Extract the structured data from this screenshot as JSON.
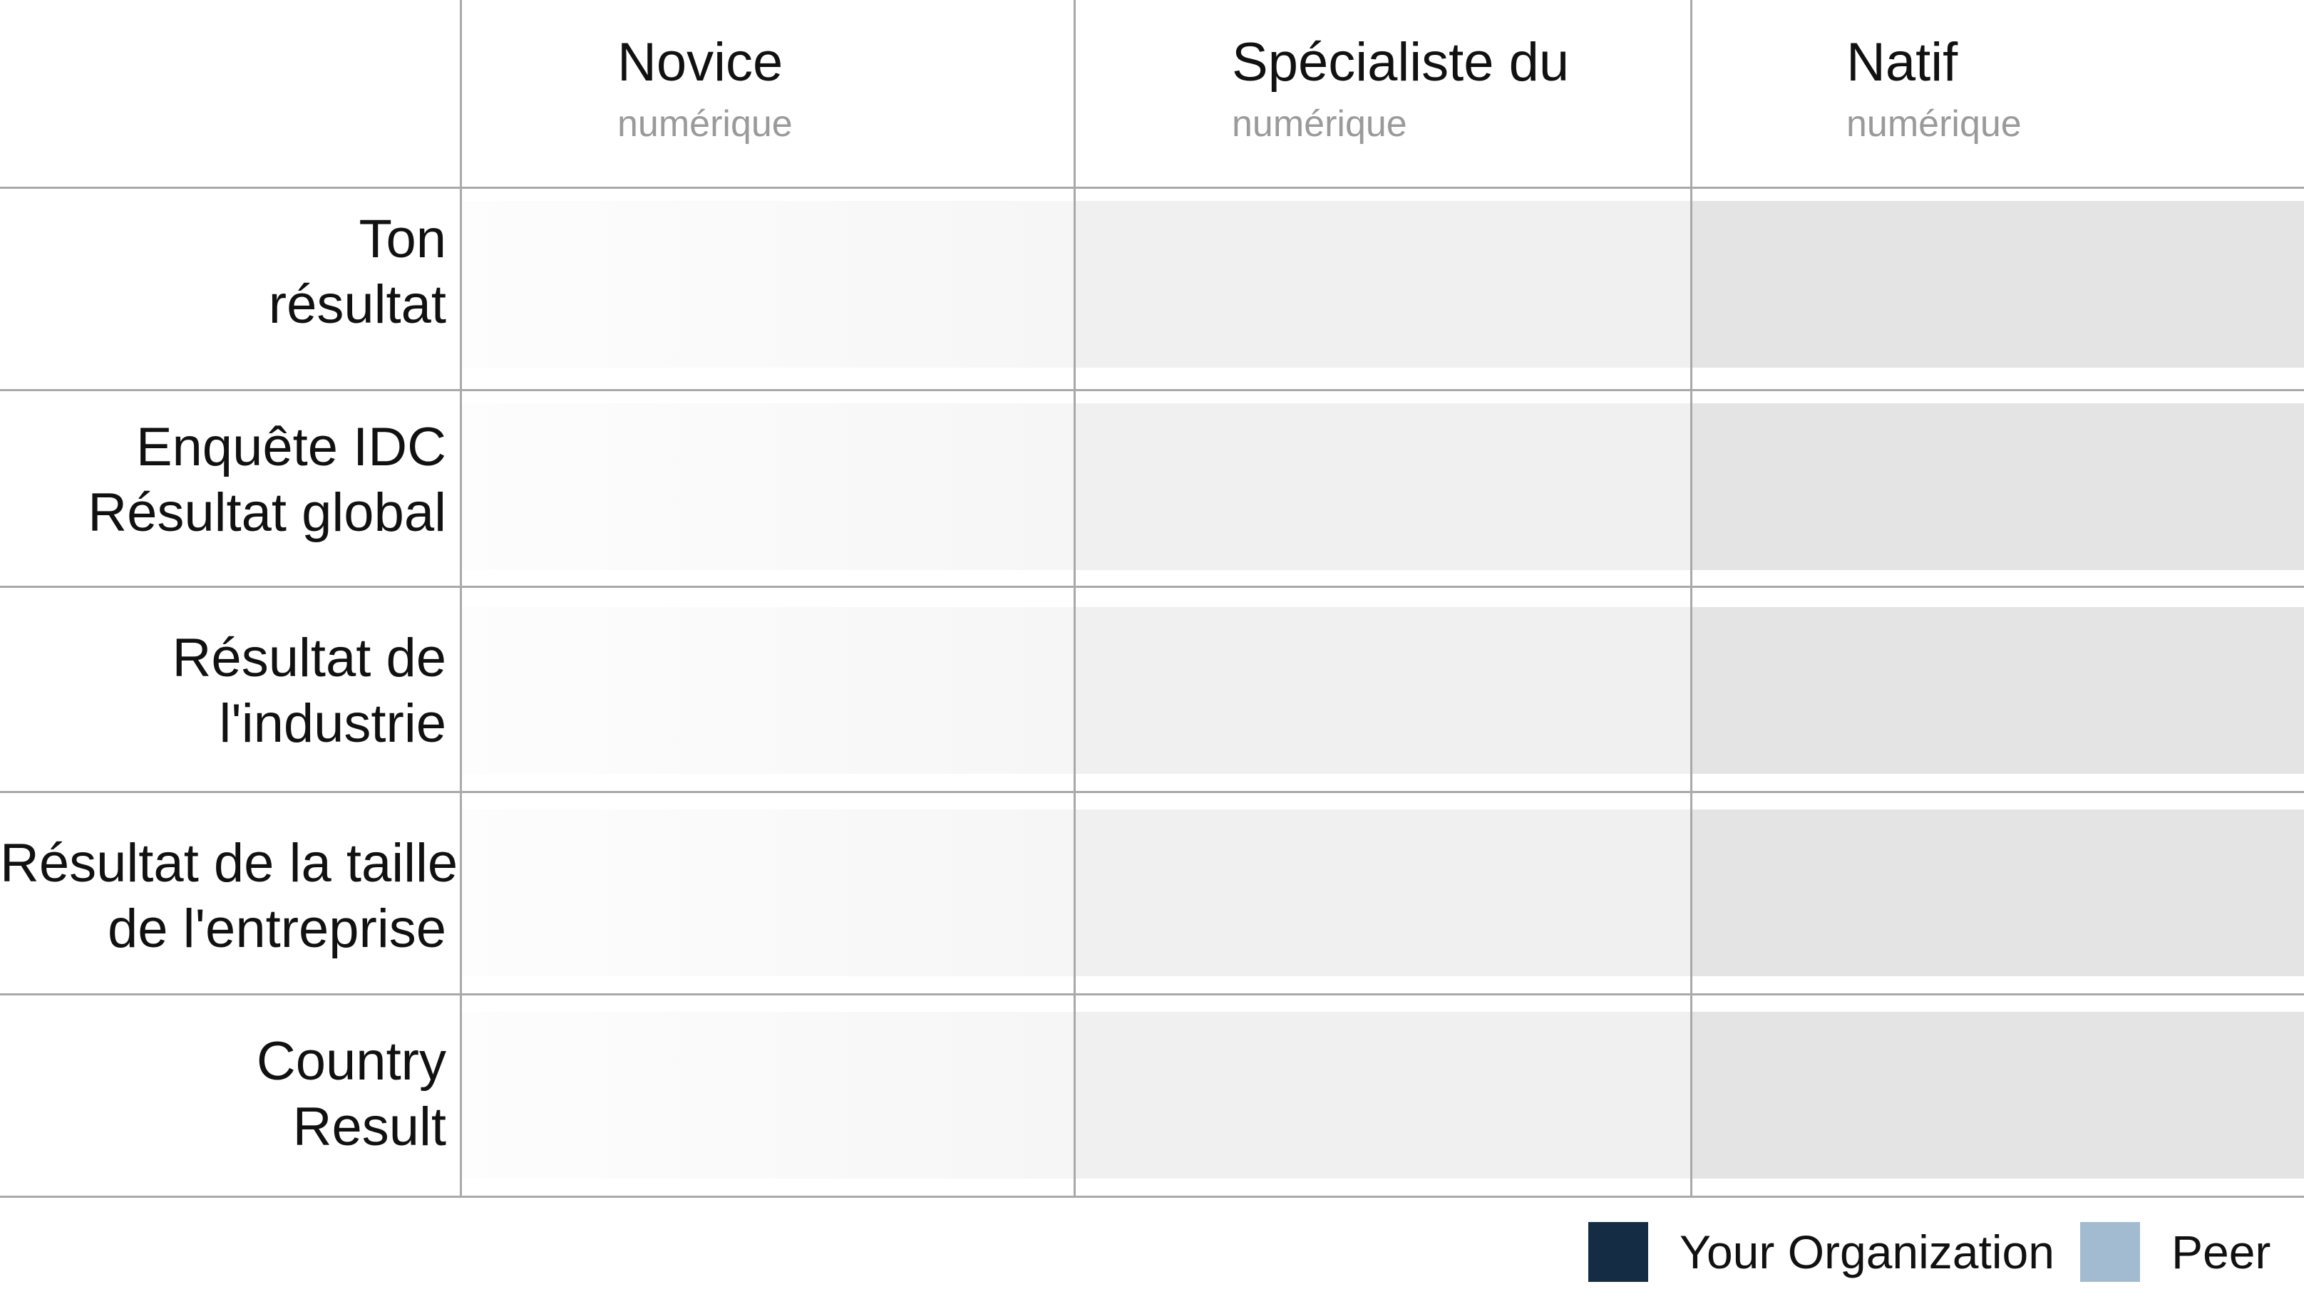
{
  "chart_data": {
    "type": "table",
    "columns": [
      {
        "title": "Novice",
        "subtitle": "numérique"
      },
      {
        "title": "Spécialiste du",
        "subtitle": "numérique"
      },
      {
        "title": "Natif",
        "subtitle": "numérique"
      }
    ],
    "rows": [
      {
        "label_line1": "Ton",
        "label_line2": "résultat"
      },
      {
        "label_line1": "Enquête IDC",
        "label_line2": "Résultat global"
      },
      {
        "label_line1": "Résultat de",
        "label_line2": "l'industrie"
      },
      {
        "label_line1": "Résultat de la taille",
        "label_line2": "de l'entreprise"
      },
      {
        "label_line1": "Country",
        "label_line2": "Result"
      }
    ],
    "legend": {
      "placement": "bottom-right",
      "items": [
        {
          "label": "Your Organization",
          "color": "#142c44"
        },
        {
          "label": "Peer",
          "color": "#a3bbd1"
        }
      ]
    },
    "grid": true
  }
}
